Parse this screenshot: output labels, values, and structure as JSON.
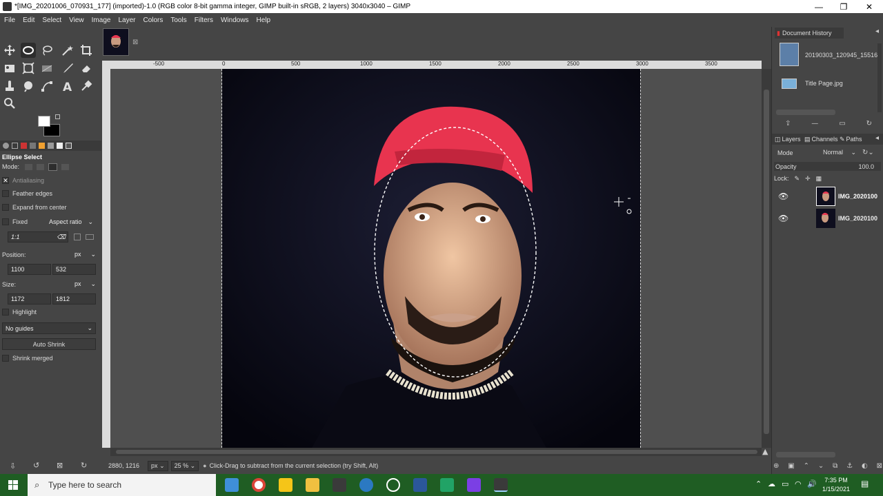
{
  "window": {
    "title": "*[IMG_20201006_070931_177] (imported)-1.0 (RGB color 8-bit gamma integer, GIMP built-in sRGB, 2 layers) 3040x3040 – GIMP",
    "minimize": "—",
    "maximize": "❐",
    "close": "✕"
  },
  "menu": [
    "File",
    "Edit",
    "Select",
    "View",
    "Image",
    "Layer",
    "Colors",
    "Tools",
    "Filters",
    "Windows",
    "Help"
  ],
  "tool_options": {
    "title": "Ellipse Select",
    "mode_label": "Mode:",
    "antialiasing": "Antialiasing",
    "feather_edges": "Feather edges",
    "expand_from_center": "Expand from center",
    "fixed": "Fixed",
    "fixed_dropdown": "Aspect ratio",
    "ratio_value": "1:1",
    "position_label": "Position:",
    "position_unit": "px",
    "position_x": "1100",
    "position_y": "532",
    "size_label": "Size:",
    "size_unit": "px",
    "size_w": "1172",
    "size_h": "1812",
    "highlight": "Highlight",
    "guides": "No guides",
    "auto_shrink": "Auto Shrink",
    "shrink_merged": "Shrink merged"
  },
  "ruler": {
    "top_labels": [
      "-500",
      "0",
      "500",
      "1000",
      "1500",
      "2000",
      "2500",
      "3000",
      "3500"
    ]
  },
  "status": {
    "coords": "2880, 1216",
    "unit": "px",
    "zoom": "25 %",
    "message": "Click-Drag to subtract from the current selection (try Shift, Alt)"
  },
  "document_history": {
    "title": "Document History",
    "items": [
      "20190303_120945_15516",
      "Title Page.jpg"
    ]
  },
  "layers_panel": {
    "tabs": [
      "Layers",
      "Channels",
      "Paths"
    ],
    "mode_label": "Mode",
    "mode_value": "Normal",
    "opacity_label": "Opacity",
    "opacity_value": "100.0",
    "lock_label": "Lock:",
    "layers": [
      "IMG_2020100",
      "IMG_2020100"
    ]
  },
  "taskbar": {
    "search_placeholder": "Type here to search",
    "time": "7:35 PM",
    "date": "1/15/2021"
  },
  "colors": {
    "taskbar": "#1f5d23",
    "cap_red": "#e8344f",
    "ui_bg": "#454545"
  }
}
